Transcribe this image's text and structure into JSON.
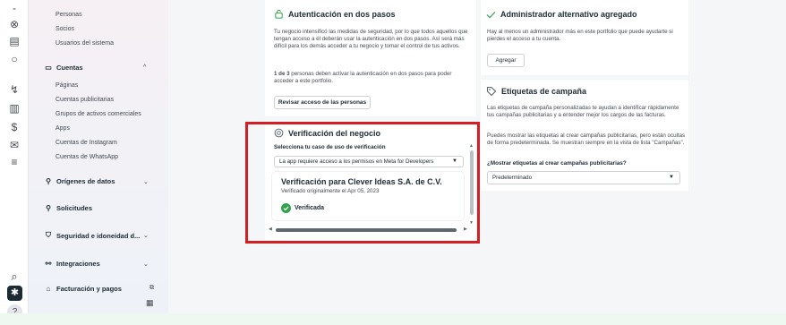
{
  "rail": {
    "items": [
      {
        "icon": "-",
        "name": "top-item-icon"
      },
      {
        "icon": "⊗",
        "name": "account-icon"
      },
      {
        "icon": "▤",
        "name": "tools-icon"
      },
      {
        "icon": "○",
        "name": "circle-icon"
      },
      {
        "icon": "↯",
        "name": "integrations-rail-icon"
      },
      {
        "icon": "▥",
        "name": "analytics-icon"
      },
      {
        "icon": "$",
        "name": "billing-rail-icon"
      },
      {
        "icon": "✉",
        "name": "messages-icon"
      },
      {
        "icon": "≡",
        "name": "menu-icon"
      }
    ],
    "search_icon": "⌕",
    "settings_icon": "✱",
    "help_icon": "?"
  },
  "sidebar": {
    "users_subitems": [
      "Personas",
      "Socios",
      "Usuarios del sistema"
    ],
    "cuentas": {
      "label": "Cuentas",
      "chevron": "^",
      "items": [
        "Páginas",
        "Cuentas publicitarias",
        "Grupos de activos comerciales",
        "Apps",
        "Cuentas de Instagram",
        "Cuentas de WhatsApp"
      ]
    },
    "sections": [
      {
        "label": "Orígenes de datos",
        "icon": "⚲",
        "chevron": "⌄"
      },
      {
        "label": "Solicitudes",
        "icon": "⚲",
        "chevron": ""
      },
      {
        "label": "Seguridad e idoneidad d...",
        "icon": "⛉",
        "chevron": "⌄"
      },
      {
        "label": "Integraciones",
        "icon": "⚯",
        "chevron": "⌄"
      },
      {
        "label": "Facturación y pagos",
        "icon": "⌂",
        "chevron": "⧉"
      }
    ],
    "footer_icon": "▦"
  },
  "two_factor": {
    "title": "Autenticación en dos pasos",
    "body": "Tu negocio intensificó las medidas de seguridad, por lo que todos aquellos que tengan acceso a él deberán usar la autenticación en dos pasos. Así será más difícil para los demás acceder a tu negocio y tomar el control de tus activos.",
    "count_bold": "1 de 3",
    "count_text": " personas deben activar la autenticación en dos pasos para poder acceder a este portfolio.",
    "button": "Revisar acceso de las personas"
  },
  "verification": {
    "title": "Verificación del negocio",
    "select_label": "Selecciona tu caso de uso de verificación",
    "select_value": "La app requiere acceso a los permisos en Meta for Developers",
    "business_name": "Verificación para Clever Ideas S.A. de C.V.",
    "verified_date": "Verificado originalmente el Apr 05, 2023",
    "status": "Verificada"
  },
  "admin": {
    "title": "Administrador alternativo agregado",
    "body": "Hay al menos un administrador más en este portfolio que puede ayudarte si pierdes el acceso a tu cuenta.",
    "button": "Agregar"
  },
  "tags": {
    "title": "Etiquetas de campaña",
    "body1": "Las etiquetas de campaña personalizadas te ayudan a identificar rápidamente tus campañas publicitarias y a entender mejor los cargos de las facturas.",
    "body2": "Puedes mostrar las etiquetas al crear campañas publicitarias, pero están ocultas de forma predeterminada. Se muestran siempre en la vista de lista \"Campañas\".",
    "question": "¿Mostrar etiquetas al crear campañas publicitarias?",
    "select_value": "Predeterminado"
  },
  "colors": {
    "highlight": "#d21f26",
    "success": "#31a24c",
    "sidebar": "#f3f0f5"
  }
}
